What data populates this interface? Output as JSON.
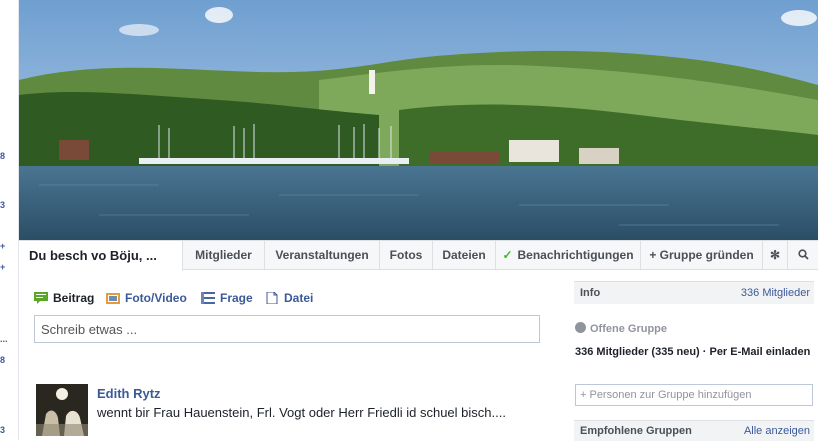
{
  "sidebar": {
    "badges": [
      "8",
      "3",
      "+",
      "+",
      "...",
      "8",
      "3"
    ]
  },
  "group": {
    "name": "Du besch vo Böju, ..."
  },
  "tabs": {
    "members": "Mitglieder",
    "events": "Veranstaltungen",
    "photos": "Fotos",
    "files": "Dateien",
    "notifications": "Benachrichtigungen",
    "create_group": "+ Gruppe gründen",
    "settings_icon": "gear-icon",
    "search_icon": "search-icon"
  },
  "composer": {
    "post": "Beitrag",
    "photo_video": "Foto/Video",
    "question": "Frage",
    "file": "Datei",
    "placeholder": "Schreib etwas ..."
  },
  "post": {
    "author": "Edith Rytz",
    "text": "wennt bir Frau Hauenstein, Frl. Vogt oder Herr Friedli id schuel bisch...."
  },
  "info": {
    "title": "Info",
    "member_count_link": "336 Mitglieder",
    "privacy": "Offene Gruppe",
    "members_detail": "336 Mitglieder (335 neu) · Per E-Mail einladen",
    "add_placeholder": "+ Personen zur Gruppe hinzufügen"
  },
  "recommended": {
    "title": "Empfohlene Gruppen",
    "see_all": "Alle anzeigen"
  },
  "colors": {
    "link": "#3b5998",
    "check": "#42b72a"
  }
}
